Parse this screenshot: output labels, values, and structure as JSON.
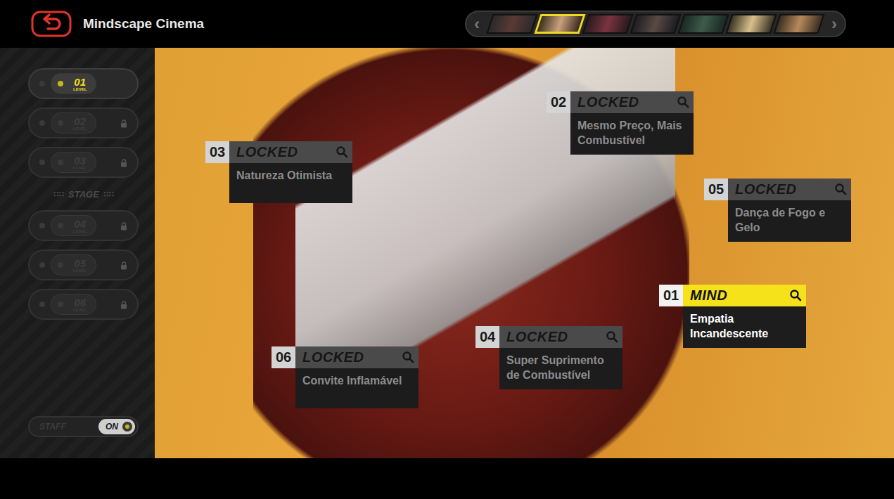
{
  "header": {
    "back": {
      "label": "Back"
    },
    "title": "Mindscape Cinema"
  },
  "character_selector": {
    "prev": "‹",
    "next": "›",
    "characters": [
      {
        "selected": false
      },
      {
        "selected": true
      },
      {
        "selected": false
      },
      {
        "selected": false
      },
      {
        "selected": false
      },
      {
        "selected": false
      },
      {
        "selected": false
      }
    ]
  },
  "sidebar": {
    "level_groups": [
      [
        {
          "number": "01",
          "label": "LEVEL",
          "selected": true,
          "locked": false
        },
        {
          "number": "02",
          "label": "LEVEL",
          "selected": false,
          "locked": true
        },
        {
          "number": "03",
          "label": "LEVEL",
          "selected": false,
          "locked": true
        }
      ],
      [
        {
          "number": "04",
          "label": "LEVEL",
          "selected": false,
          "locked": true
        },
        {
          "number": "05",
          "label": "LEVEL",
          "selected": false,
          "locked": true
        },
        {
          "number": "06",
          "label": "LEVEL",
          "selected": false,
          "locked": true
        }
      ]
    ],
    "divider": "STAGE",
    "toggle": {
      "label": "STAFF",
      "value": "ON",
      "on": true
    }
  },
  "mindscapes": [
    {
      "number": "03",
      "status": "LOCKED",
      "title": "Natureza Otimista",
      "selected": false,
      "locked": true
    },
    {
      "number": "02",
      "status": "LOCKED",
      "title": "Mesmo Preço, Mais Combustível",
      "selected": false,
      "locked": true
    },
    {
      "number": "05",
      "status": "LOCKED",
      "title": "Dança de Fogo e Gelo",
      "selected": false,
      "locked": true
    },
    {
      "number": "01",
      "status": "MIND",
      "title": "Empatia Incandescente",
      "selected": true,
      "locked": false
    },
    {
      "number": "04",
      "status": "LOCKED",
      "title": "Super Suprimento de Combustível",
      "selected": false,
      "locked": true
    },
    {
      "number": "06",
      "status": "LOCKED",
      "title": "Convite Inflamável",
      "selected": false,
      "locked": true
    }
  ]
}
